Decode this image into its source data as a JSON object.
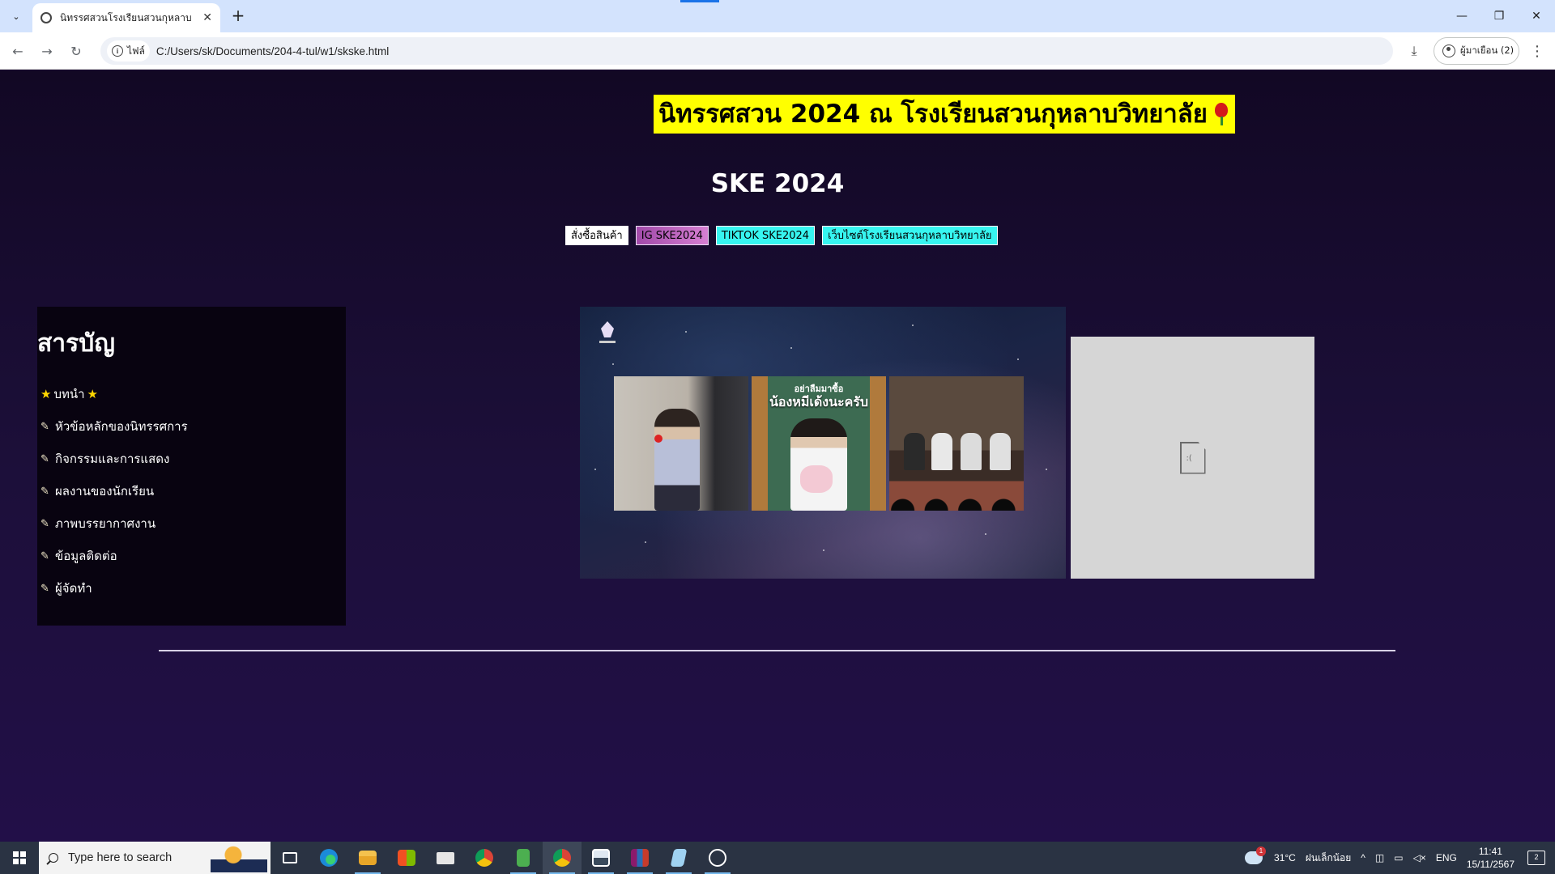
{
  "browser": {
    "tab_title": "นิทรรศสวนโรงเรียนสวนกุหลาบ",
    "url": "C:/Users/sk/Documents/204-4-tul/w1/skske.html",
    "site_chip_label": "ไฟล์",
    "profile_label": "ผู้มาเยือน (2)"
  },
  "page": {
    "main_heading": "นิทรรศสวน 2024 ณ โรงเรียนสวนกุหลาบวิทยาลัย",
    "sub_heading": "SKE 2024",
    "nav_links": [
      {
        "label": "สั่งซื้อสินค้า"
      },
      {
        "label": "IG SKE2024"
      },
      {
        "label": "TIKTOK SKE2024"
      },
      {
        "label": "เว็บไซต์โรงเรียนสวนกุหลาบวิทยาลัย"
      }
    ],
    "toc": {
      "title": "สารบัญ",
      "items": [
        {
          "label": "บทนำ"
        },
        {
          "label": "หัวข้อหลักของนิทรรศการ"
        },
        {
          "label": "กิจกรรมและการแสดง"
        },
        {
          "label": "ผลงานของนักเรียน"
        },
        {
          "label": "ภาพบรรยากาศงาน"
        },
        {
          "label": "ข้อมูลติดต่อ"
        },
        {
          "label": "ผู้จัดทำ"
        }
      ]
    },
    "hero": {
      "caption_small": "อย่าลืมมาซื้อ",
      "caption_big": "น้องหมีเด้งนะครับ"
    }
  },
  "taskbar": {
    "search_placeholder": "Type here to search",
    "weather": "31°C",
    "weather_desc": "ฝนเล็กน้อย",
    "language": "ENG",
    "time": "11:41",
    "date": "15/11/2567",
    "notification_count": "2"
  }
}
